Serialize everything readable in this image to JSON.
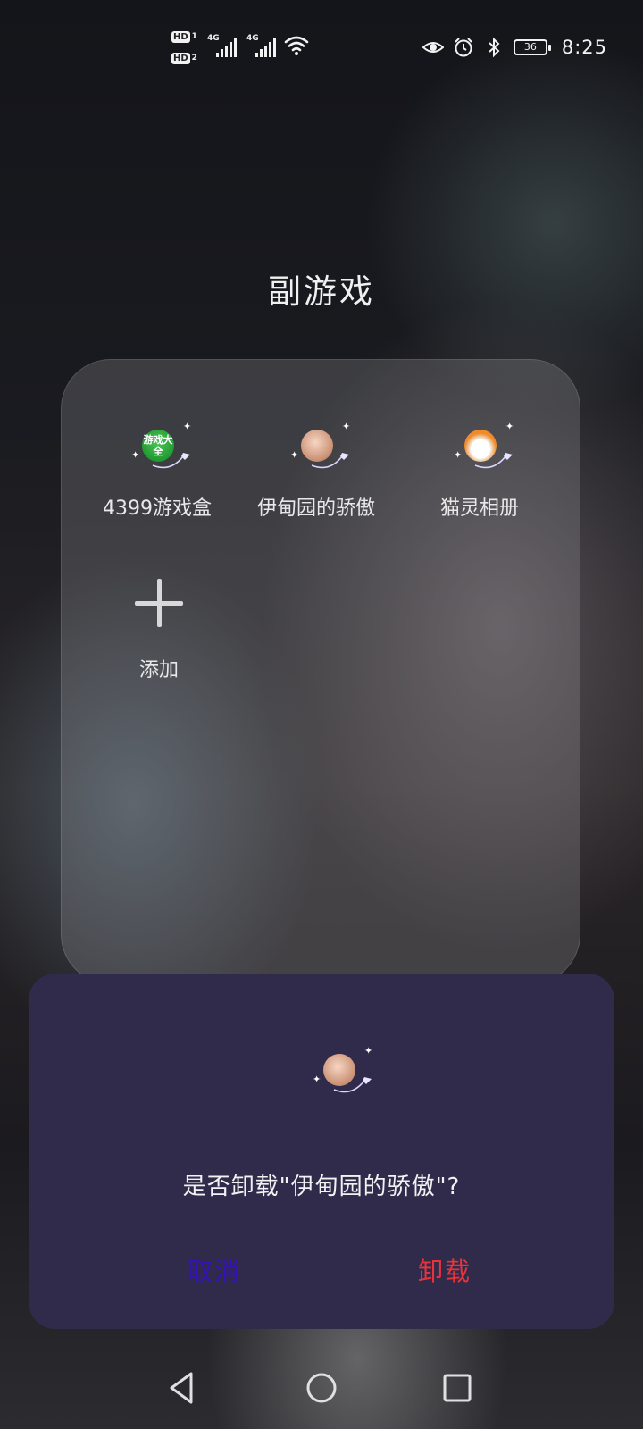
{
  "status_bar": {
    "sim1": {
      "badge": "HD",
      "slot": "1",
      "network": "4G"
    },
    "sim2": {
      "badge": "HD",
      "slot": "2",
      "network": "4G"
    },
    "battery_level": "36",
    "time": "8:25"
  },
  "folder": {
    "title": "副游戏",
    "apps": [
      {
        "label": "4399游戏盒",
        "icon": "4399-game-box-icon",
        "icon_text": "游戏大全"
      },
      {
        "label": "伊甸园的骄傲",
        "icon": "aristocrat-avatar-icon"
      },
      {
        "label": "猫灵相册",
        "icon": "cat-album-icon"
      }
    ],
    "add_label": "添加"
  },
  "dialog": {
    "message": "是否卸载\"伊甸园的骄傲\"?",
    "cancel_label": "取消",
    "confirm_label": "卸载",
    "cancel_color": "#3412b8",
    "confirm_color": "#e8333b"
  },
  "navigation": {
    "back": "back-triangle-icon",
    "home": "home-circle-icon",
    "recent": "recent-apps-square-icon"
  }
}
